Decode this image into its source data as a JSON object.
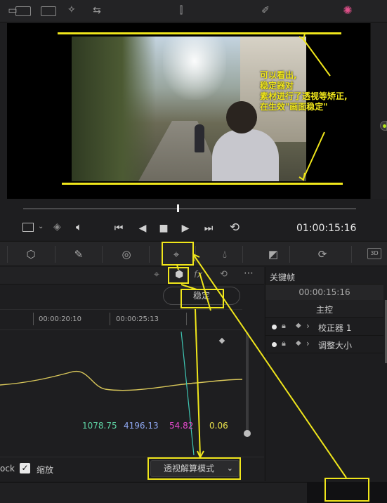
{
  "annotation": {
    "note": "可以看出,\n稳定器对\n素材进行了透视等矫正,\n在生效\"画面稳定\""
  },
  "viewer": {
    "timecode": "01:00:15:16",
    "scrub_position_fraction": 0.47
  },
  "transport": {
    "prev": "⏮",
    "rewind": "◀",
    "stop": "■",
    "play": "▶",
    "next": "⏭",
    "loop": "⟲"
  },
  "tracker": {
    "stabilize_label": "稳定",
    "fx_label": "fx",
    "mode_dropdown": "透视解算模式",
    "zoom_label": "缩放",
    "lock_label": "ock",
    "zoom_checked": true
  },
  "ruler": {
    "t1": "00:00:20:10",
    "t2": "00:00:25:13"
  },
  "values": {
    "v1": "1078.75",
    "v2": "4196.13",
    "v3": "54.82",
    "v4": "0.06"
  },
  "value_colors": {
    "v1": "#5fd6a6",
    "v2": "#8fa8f2",
    "v3": "#e84ad0",
    "v4": "#e8e14b"
  },
  "keyframes": {
    "title": "关键帧",
    "time": "00:00:15:16",
    "master": "主控",
    "rows": [
      "校正器 1",
      "调整大小"
    ]
  },
  "palette": {
    "three_d": "3D"
  },
  "colors": {
    "annotation": "#f0e61b",
    "background": "#1c1c1e"
  }
}
